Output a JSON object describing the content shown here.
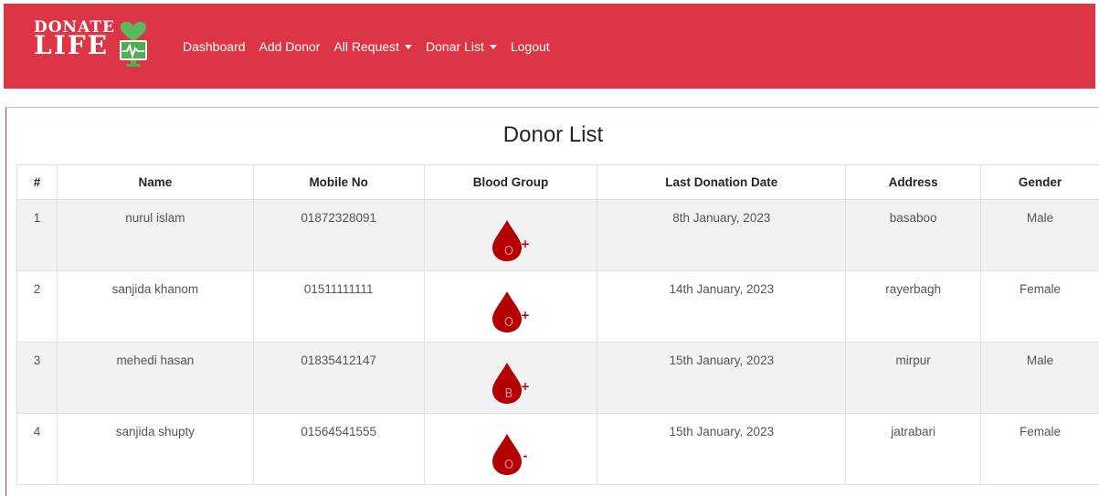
{
  "brand": {
    "line1": "DONATE",
    "line2": "LIFE"
  },
  "nav": [
    {
      "label": "Dashboard",
      "dropdown": false
    },
    {
      "label": "Add Donor",
      "dropdown": false
    },
    {
      "label": "All Request",
      "dropdown": true
    },
    {
      "label": "Donar List",
      "dropdown": true
    },
    {
      "label": "Logout",
      "dropdown": false
    }
  ],
  "page": {
    "title": "Donor List"
  },
  "table": {
    "headers": [
      "#",
      "Name",
      "Mobile No",
      "Blood Group",
      "Last Donation Date",
      "Address",
      "Gender"
    ],
    "rows": [
      {
        "num": "1",
        "name": "nurul islam",
        "mobile": "01872328091",
        "blood_type": "O",
        "blood_sign": "+",
        "date": "8th January, 2023",
        "address": "basaboo",
        "gender": "Male"
      },
      {
        "num": "2",
        "name": "sanjida khanom",
        "mobile": "01511111111",
        "blood_type": "O",
        "blood_sign": "+",
        "date": "14th January, 2023",
        "address": "rayerbagh",
        "gender": "Female"
      },
      {
        "num": "3",
        "name": "mehedi hasan",
        "mobile": "01835412147",
        "blood_type": "B",
        "blood_sign": "+",
        "date": "15th January, 2023",
        "address": "mirpur",
        "gender": "Male"
      },
      {
        "num": "4",
        "name": "sanjida shupty",
        "mobile": "01564541555",
        "blood_type": "O",
        "blood_sign": "-",
        "date": "15th January, 2023",
        "address": "jatrabari",
        "gender": "Female"
      }
    ]
  },
  "colors": {
    "navbar": "#dc3545",
    "male": "#2e7d32",
    "female": "#17a2b8",
    "blood": "#b30000"
  }
}
